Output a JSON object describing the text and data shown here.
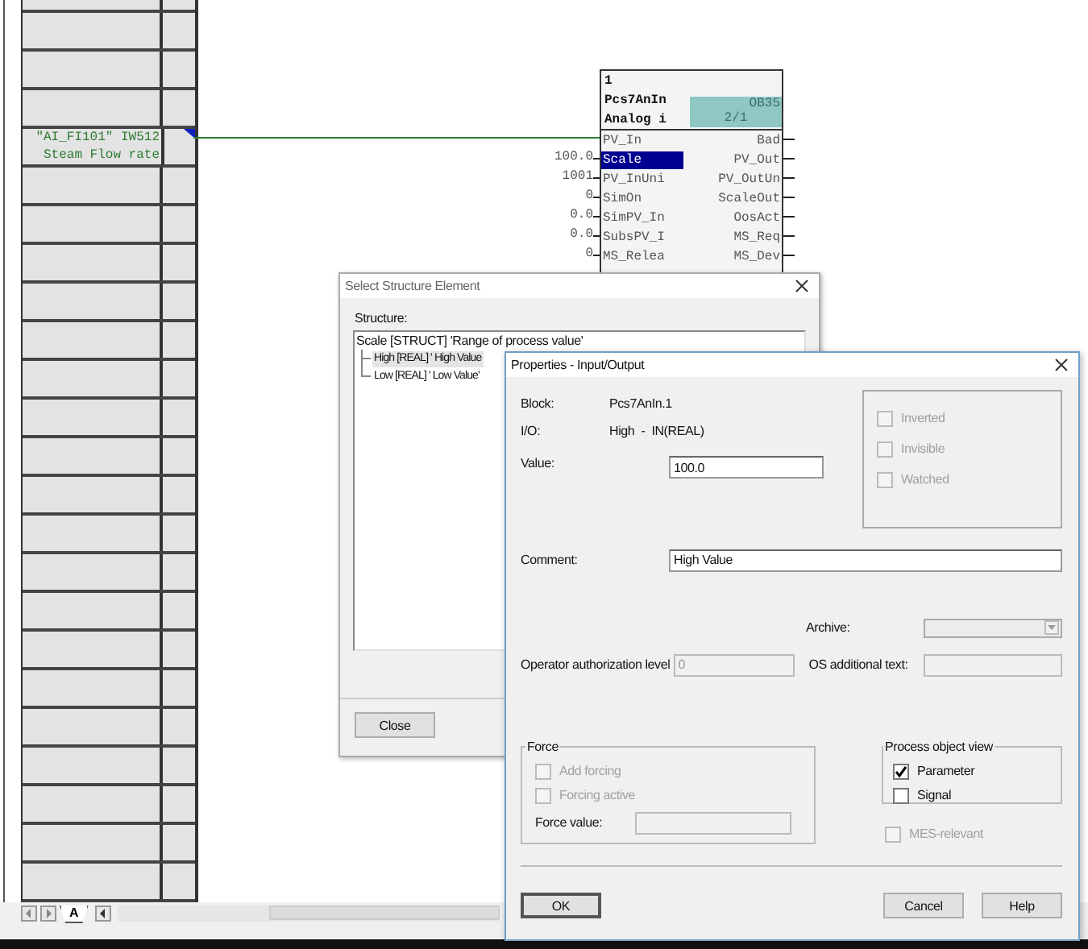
{
  "sheet": {
    "signal": {
      "address": "\"AI_FI101\" IW512",
      "comment": "Steam Flow rate"
    },
    "tabs": [
      {
        "label": "A",
        "selected": true
      }
    ]
  },
  "block": {
    "number": "1",
    "type": "Pcs7AnIn",
    "name": "Analog i",
    "task": "OB35",
    "sequence": "2/1",
    "inputs": [
      {
        "name": "PV_In",
        "selected": false
      },
      {
        "name": "Scale",
        "value": "100.0",
        "selected": true
      },
      {
        "name": "PV_InUni",
        "value": "1001",
        "selected": false
      },
      {
        "name": "SimOn",
        "value": "0",
        "selected": false
      },
      {
        "name": "SimPV_In",
        "value": "0.0",
        "selected": false
      },
      {
        "name": "SubsPV_I",
        "value": "0.0",
        "selected": false
      },
      {
        "name": "MS_Relea",
        "value": "0",
        "selected": false
      }
    ],
    "outputs": [
      "Bad",
      "PV_Out",
      "PV_OutUn",
      "ScaleOut",
      "OosAct",
      "MS_Req",
      "MS_Dev"
    ]
  },
  "structure_dialog": {
    "title": "Select Structure Element",
    "label": "Structure:",
    "items": [
      {
        "text": "Scale [STRUCT] 'Range of process value'",
        "selected": false,
        "children": [
          {
            "text": "High [REAL] ' High Value",
            "selected": true
          },
          {
            "text": "Low [REAL] ' Low Value'",
            "selected": false
          }
        ]
      }
    ],
    "close_button": "Close"
  },
  "properties_dialog": {
    "title": "Properties - Input/Output",
    "block_label": "Block:",
    "block": "Pcs7AnIn.1",
    "io_label": "I/O:",
    "io": "High  -  IN(REAL)",
    "value_label": "Value:",
    "value": "100.0",
    "flags": [
      {
        "label": "Inverted",
        "checked": false,
        "disabled": true
      },
      {
        "label": "Invisible",
        "checked": false,
        "disabled": true
      },
      {
        "label": "Watched",
        "checked": false,
        "disabled": true
      }
    ],
    "comment_label": "Comment:",
    "comment": "High Value",
    "archive_label": "Archive:",
    "authorization_label": "Operator authorization level",
    "authorization": "0",
    "os_text_label": "OS additional text:",
    "force": {
      "title": "Force",
      "options": [
        {
          "label": "Add forcing",
          "checked": false,
          "disabled": true
        },
        {
          "label": "Forcing active",
          "checked": false,
          "disabled": true
        }
      ],
      "value_label": "Force value:"
    },
    "process_view": {
      "title": "Process object view",
      "options": [
        {
          "label": "Parameter",
          "checked": true,
          "disabled": false
        },
        {
          "label": "Signal",
          "checked": false,
          "disabled": false
        }
      ]
    },
    "mes": {
      "label": "MES-relevant",
      "checked": false,
      "disabled": true
    },
    "buttons": [
      "OK",
      "Cancel",
      "Help"
    ]
  }
}
